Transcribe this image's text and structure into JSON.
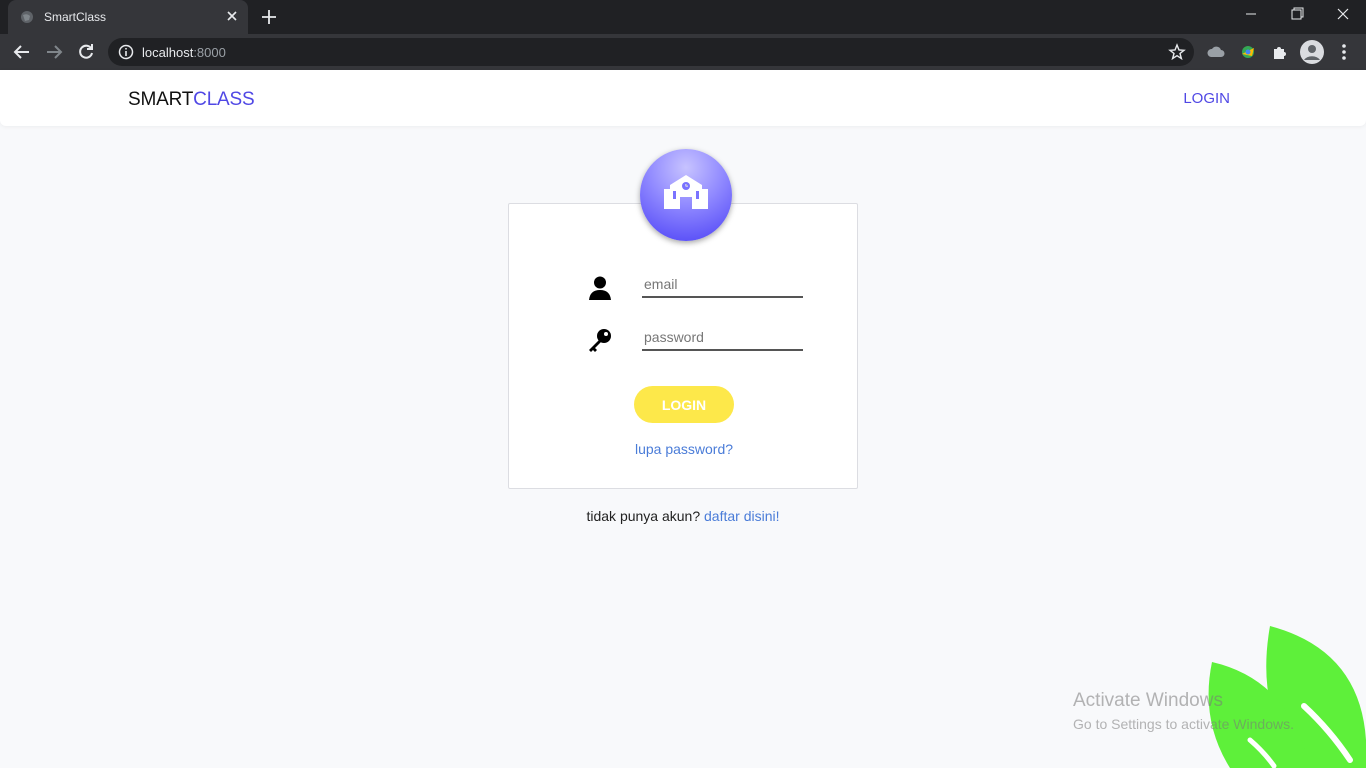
{
  "browser": {
    "tab_title": "SmartClass",
    "url_host": "localhost",
    "url_port": ":8000"
  },
  "navbar": {
    "brand_part1": "SMART",
    "brand_part2": "CLASS",
    "login_link": "LOGIN"
  },
  "login_form": {
    "email_placeholder": "email",
    "password_placeholder": "password",
    "submit_label": "LOGIN",
    "forgot_link": "lupa password?"
  },
  "register": {
    "prompt": "tidak punya akun? ",
    "link": "daftar disini!"
  },
  "watermark": {
    "line1": "Activate Windows",
    "line2": "Go to Settings to activate Windows."
  },
  "colors": {
    "accent": "#5048e5",
    "button": "#fde84a",
    "link": "#4a7cd8",
    "leaf": "#5ef03a"
  }
}
